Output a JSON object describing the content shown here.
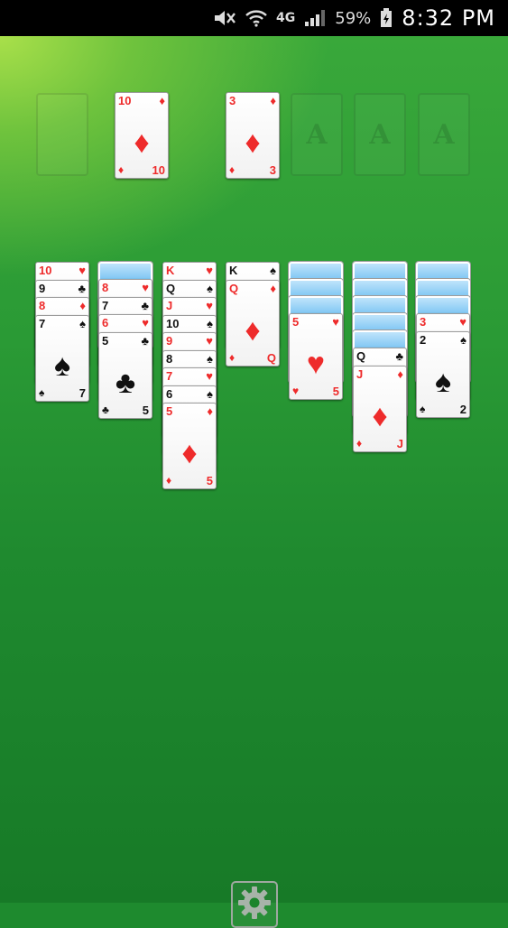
{
  "status_bar": {
    "network": "4G",
    "battery": "59%",
    "time": "8:32 PM",
    "icons": [
      "mute-icon",
      "wifi-icon",
      "network-4g-icon",
      "signal-icon",
      "battery-charging-icon"
    ]
  },
  "colors": {
    "felt_light": "#a9e04a",
    "felt": "#1f8a2f",
    "red_suit": "#ee2b2b",
    "black_suit": "#111111",
    "card_back": "#2d97dc"
  },
  "suits": {
    "hearts": "♥",
    "diamonds": "♦",
    "clubs": "♣",
    "spades": "♠"
  },
  "stock": {
    "empty": true
  },
  "waste": [
    {
      "rank": "10",
      "suit": "diamonds"
    }
  ],
  "foundations": [
    {
      "rank": "3",
      "suit": "diamonds"
    },
    {
      "placeholder": "A"
    },
    {
      "placeholder": "A"
    },
    {
      "placeholder": "A"
    }
  ],
  "tableau": [
    {
      "face_down": 0,
      "cards": [
        {
          "rank": "10",
          "suit": "hearts"
        },
        {
          "rank": "9",
          "suit": "clubs"
        },
        {
          "rank": "8",
          "suit": "diamonds"
        },
        {
          "rank": "7",
          "suit": "spades"
        }
      ]
    },
    {
      "face_down": 1,
      "cards": [
        {
          "rank": "8",
          "suit": "hearts"
        },
        {
          "rank": "7",
          "suit": "clubs"
        },
        {
          "rank": "6",
          "suit": "hearts"
        },
        {
          "rank": "5",
          "suit": "clubs"
        }
      ]
    },
    {
      "face_down": 0,
      "cards": [
        {
          "rank": "K",
          "suit": "hearts"
        },
        {
          "rank": "Q",
          "suit": "spades"
        },
        {
          "rank": "J",
          "suit": "hearts"
        },
        {
          "rank": "10",
          "suit": "spades"
        },
        {
          "rank": "9",
          "suit": "hearts"
        },
        {
          "rank": "8",
          "suit": "spades"
        },
        {
          "rank": "7",
          "suit": "hearts"
        },
        {
          "rank": "6",
          "suit": "spades"
        },
        {
          "rank": "5",
          "suit": "diamonds"
        }
      ]
    },
    {
      "face_down": 0,
      "cards": [
        {
          "rank": "K",
          "suit": "spades"
        },
        {
          "rank": "Q",
          "suit": "diamonds"
        }
      ]
    },
    {
      "face_down": 3,
      "cards": [
        {
          "rank": "5",
          "suit": "hearts"
        }
      ]
    },
    {
      "face_down": 5,
      "cards": [
        {
          "rank": "Q",
          "suit": "clubs"
        },
        {
          "rank": "J",
          "suit": "diamonds"
        }
      ]
    },
    {
      "face_down": 3,
      "cards": [
        {
          "rank": "3",
          "suit": "hearts"
        },
        {
          "rank": "2",
          "suit": "spades"
        }
      ]
    }
  ],
  "toolbar": {
    "settings_icon": "gear-icon"
  }
}
